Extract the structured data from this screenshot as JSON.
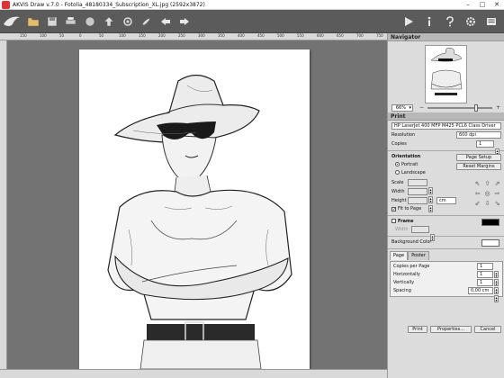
{
  "window": {
    "title": "AKVIS Draw v.7.0 - Fotolia_48180334_Subscription_XL.jpg (2592x3872)",
    "minimize": "–",
    "maximize": "□",
    "close": "✕"
  },
  "toolbar": {
    "icons": [
      "open-icon",
      "save-icon",
      "print-icon",
      "share-icon",
      "upload-icon",
      "batch-icon",
      "brush-icon",
      "undo-icon",
      "redo-icon"
    ],
    "right_icons": [
      "run-icon",
      "info-icon",
      "help-icon",
      "settings-icon",
      "news-icon"
    ]
  },
  "rulers": {
    "top": [
      "150",
      "100",
      "50",
      "0",
      "50",
      "100",
      "150",
      "200",
      "250",
      "300",
      "350",
      "400",
      "450",
      "500",
      "550",
      "600",
      "650",
      "700",
      "750"
    ]
  },
  "navigator": {
    "title": "Navigator",
    "zoom": "66%",
    "zoom_out": "−",
    "zoom_in": "+"
  },
  "print": {
    "title": "Print",
    "printer": "HP LaserJet 400 MFP M425 PCL6 Class Driver",
    "resolution_label": "Resolution",
    "resolution_value": "600 dpi",
    "copies_label": "Copies",
    "copies_value": "1",
    "orientation_label": "Orientation",
    "portrait": "Portrait",
    "landscape": "Landscape",
    "page_setup": "Page Setup",
    "reset_margins": "Reset Margins",
    "scale_label": "Scale",
    "width_label": "Width",
    "height_label": "Height",
    "unit": "cm",
    "fit_to_page": "Fit to Page",
    "frame_label": "Frame",
    "frame_width_label": "Width",
    "background_color_label": "Background Color",
    "tab_page": "Page",
    "tab_poster": "Poster",
    "copies_per_page_label": "Copies per Page",
    "copies_per_page_value": "1",
    "horizontally_label": "Horizontally",
    "horizontally_value": "1",
    "vertically_label": "Vertically",
    "vertically_value": "1",
    "spacing_label": "Spacing",
    "spacing_value": "0,00 cm",
    "btn_print": "Print",
    "btn_properties": "Properties...",
    "btn_cancel": "Cancel"
  },
  "colors": {
    "frame_color": "#000000",
    "background_color": "#ffffff"
  }
}
